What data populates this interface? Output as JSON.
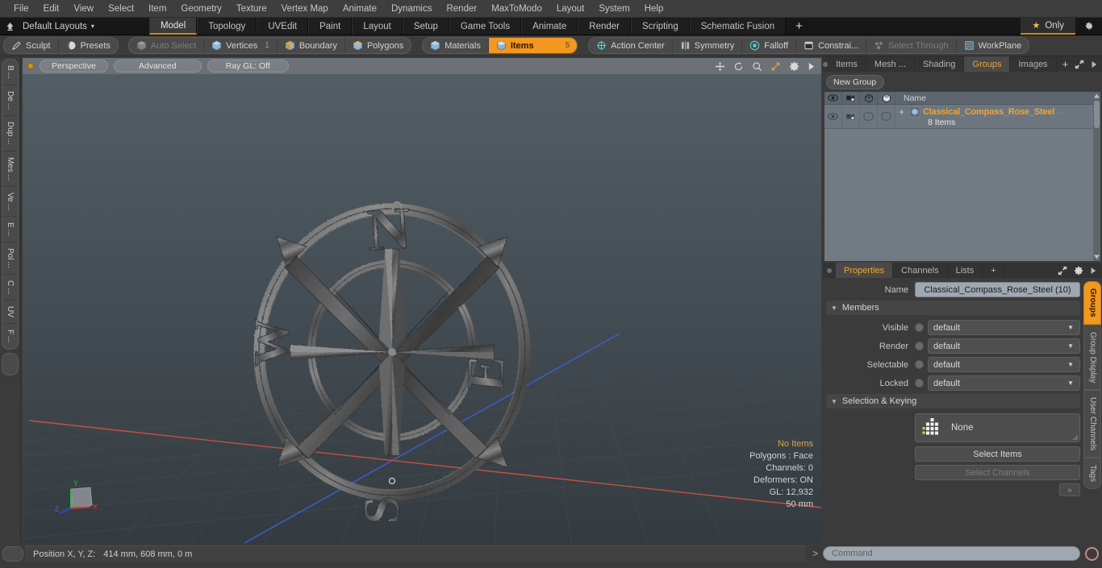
{
  "menubar": {
    "items": [
      "File",
      "Edit",
      "View",
      "Select",
      "Item",
      "Geometry",
      "Texture",
      "Vertex Map",
      "Animate",
      "Dynamics",
      "Render",
      "MaxToModo",
      "Layout",
      "System",
      "Help"
    ]
  },
  "layoutbar": {
    "layouts_label": "Default Layouts",
    "caret": "▾",
    "tabs": [
      {
        "label": "Model",
        "active": true
      },
      {
        "label": "Topology",
        "active": false
      },
      {
        "label": "UVEdit",
        "active": false
      },
      {
        "label": "Paint",
        "active": false
      },
      {
        "label": "Layout",
        "active": false
      },
      {
        "label": "Setup",
        "active": false
      },
      {
        "label": "Game Tools",
        "active": false
      },
      {
        "label": "Animate",
        "active": false
      },
      {
        "label": "Render",
        "active": false
      },
      {
        "label": "Scripting",
        "active": false
      },
      {
        "label": "Schematic Fusion",
        "active": false
      }
    ],
    "plus": "+",
    "only_label": "Only",
    "star": "★"
  },
  "modebar": {
    "group1": [
      {
        "label": "Sculpt",
        "icon": "pen-icon",
        "state": "normal"
      },
      {
        "label": "Presets",
        "icon": "sphere-icon",
        "state": "normal"
      }
    ],
    "group2": [
      {
        "label": "Auto Select",
        "icon": "cube-gray-icon",
        "state": "dim",
        "num": ""
      },
      {
        "label": "Vertices",
        "icon": "cube-blue-icon",
        "state": "normal",
        "num": "1"
      },
      {
        "label": "Boundary",
        "icon": "cube-orange-icon",
        "state": "normal",
        "num": ""
      },
      {
        "label": "Polygons",
        "icon": "cube-blue-icon",
        "state": "normal",
        "num": ""
      }
    ],
    "group3": [
      {
        "label": "Materials",
        "icon": "cube-blue-icon",
        "state": "normal",
        "num": ""
      },
      {
        "label": "Items",
        "icon": "cube-blue-icon",
        "state": "selected",
        "num": "5"
      }
    ],
    "group4": [
      {
        "label": "Action Center",
        "icon": "crosshair-icon",
        "state": "normal"
      },
      {
        "label": "Symmetry",
        "icon": "symmetry-icon",
        "state": "normal"
      },
      {
        "label": "Falloff",
        "icon": "falloff-icon",
        "state": "normal"
      },
      {
        "label": "Constrai...",
        "icon": "constraint-icon",
        "state": "normal"
      },
      {
        "label": "Select Through",
        "icon": "select-through-icon",
        "state": "dim"
      },
      {
        "label": "WorkPlane",
        "icon": "workplane-icon",
        "state": "normal"
      }
    ]
  },
  "left_toolbar": {
    "tabs": [
      "B ...",
      "De ...",
      "Dup ...",
      "Mes ...",
      "Ve ...",
      "E ...",
      "Pol ...",
      "C ...",
      "UV",
      "F ..."
    ]
  },
  "viewport": {
    "header_buttons": [
      "Perspective",
      "Advanced",
      "Ray GL: Off"
    ],
    "icons": [
      "move-icon",
      "rotate-icon",
      "zoom-icon",
      "fit-icon",
      "gear-icon",
      "play-icon"
    ],
    "stats": {
      "selection": "No Items",
      "polygons": "Polygons : Face",
      "channels": "Channels: 0",
      "deformers": "Deformers: ON",
      "gl": "GL: 12,932",
      "scale": "50 mm"
    },
    "axis": {
      "x": "X",
      "y": "Y",
      "z": "Z"
    },
    "model": {
      "name": "Classical Compass Rose",
      "cardinals": [
        "N",
        "E",
        "S",
        "W"
      ]
    }
  },
  "right_panel": {
    "tabs": [
      {
        "label": "Items",
        "active": false
      },
      {
        "label": "Mesh ...",
        "active": false
      },
      {
        "label": "Shading",
        "active": false
      },
      {
        "label": "Groups",
        "active": true
      },
      {
        "label": "Images",
        "active": false
      }
    ],
    "plus": "+",
    "new_group_label": "New Group",
    "tree": {
      "columns": [
        "eye-icon",
        "render-icon",
        "wire-icon",
        "shade-icon"
      ],
      "name_header": "Name",
      "rows": [
        {
          "name": "Classical_Compass_Rose_Steel",
          "sub": "8 Items",
          "plus": "+",
          "dots": "..."
        }
      ]
    }
  },
  "properties": {
    "tabs": [
      {
        "label": "Properties",
        "active": true
      },
      {
        "label": "Channels",
        "active": false
      },
      {
        "label": "Lists",
        "active": false
      }
    ],
    "plus": "+",
    "name_label": "Name",
    "name_value": "Classical_Compass_Rose_Steel (10)",
    "members_section": "Members",
    "members": [
      {
        "label": "Visible",
        "value": "default"
      },
      {
        "label": "Render",
        "value": "default"
      },
      {
        "label": "Selectable",
        "value": "default"
      },
      {
        "label": "Locked",
        "value": "default"
      }
    ],
    "selection_section": "Selection & Keying",
    "selection_set": "None",
    "select_items_label": "Select Items",
    "select_channels_label": "Select Channels",
    "expand_label": "»",
    "vtabs": [
      {
        "label": "Groups",
        "active": true
      },
      {
        "label": "Group Display",
        "active": false
      },
      {
        "label": "User Channels",
        "active": false
      },
      {
        "label": "Tags",
        "active": false
      }
    ]
  },
  "statusbar": {
    "position_label": "Position X, Y, Z:",
    "position_value": "414 mm, 608 mm, 0 m",
    "command_prefix": ">",
    "command_placeholder": "Command"
  },
  "colors": {
    "accent": "#f2971f",
    "tab_underline": "#d08a21",
    "panel_bg": "#3b3b3b",
    "tree_bg": "#6d767f",
    "highlight_text": "#f0a42f"
  }
}
